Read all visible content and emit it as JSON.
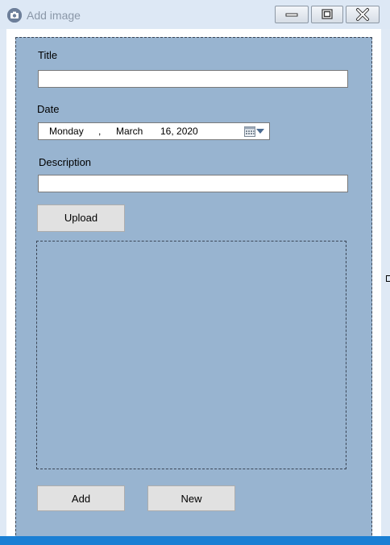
{
  "window": {
    "title": "Add image",
    "icon": "camera-icon",
    "controls": {
      "minimize_icon": "minimize-icon",
      "maximize_icon": "maximize-icon",
      "close_icon": "close-icon"
    }
  },
  "form": {
    "title_label": "Title",
    "title_value": "",
    "date_label": "Date",
    "date": {
      "weekday": "Monday",
      "separator": ",",
      "month": "March",
      "day_year": "16, 2020",
      "calendar_icon": "calendar-icon",
      "dropdown_icon": "dropdown-arrow-icon"
    },
    "description_label": "Description",
    "description_value": "",
    "upload_button": "Upload",
    "add_button": "Add",
    "new_button": "New"
  },
  "colors": {
    "panel_background": "#98b4d0",
    "taskbar": "#1a7fd4",
    "button_face": "#e1e1e1"
  }
}
